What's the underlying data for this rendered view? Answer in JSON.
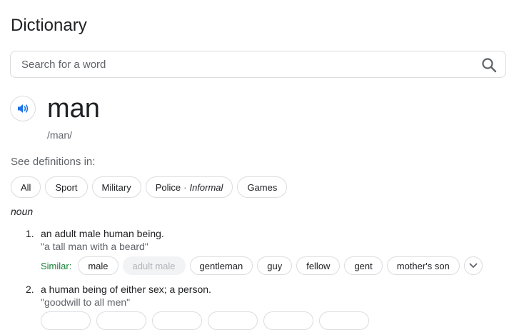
{
  "title": "Dictionary",
  "search": {
    "placeholder": "Search for a word"
  },
  "entry": {
    "word": "man",
    "phonetic": "/man/"
  },
  "definitions_in": {
    "label": "See definitions in:",
    "chips": [
      {
        "label": "All"
      },
      {
        "label": "Sport"
      },
      {
        "label": "Military"
      },
      {
        "label": "Police",
        "separator": "·",
        "register": "Informal"
      },
      {
        "label": "Games"
      }
    ]
  },
  "part_of_speech": "noun",
  "senses": [
    {
      "number": "1.",
      "definition": "an adult male human being.",
      "example": "\"a tall man with a beard\"",
      "similar_label": "Similar:",
      "synonyms": [
        "male",
        "adult male",
        "gentleman",
        "guy",
        "fellow",
        "gent",
        "mother's son"
      ]
    },
    {
      "number": "2.",
      "definition": "a human being of either sex; a person.",
      "example": "\"goodwill to all men\""
    }
  ],
  "colors": {
    "similar_label": "#188038",
    "speaker_icon": "#1a73e8",
    "border": "#dadce0"
  },
  "icons": {
    "search": "search-icon",
    "speaker": "speaker-icon",
    "expand": "chevron-down-icon"
  }
}
